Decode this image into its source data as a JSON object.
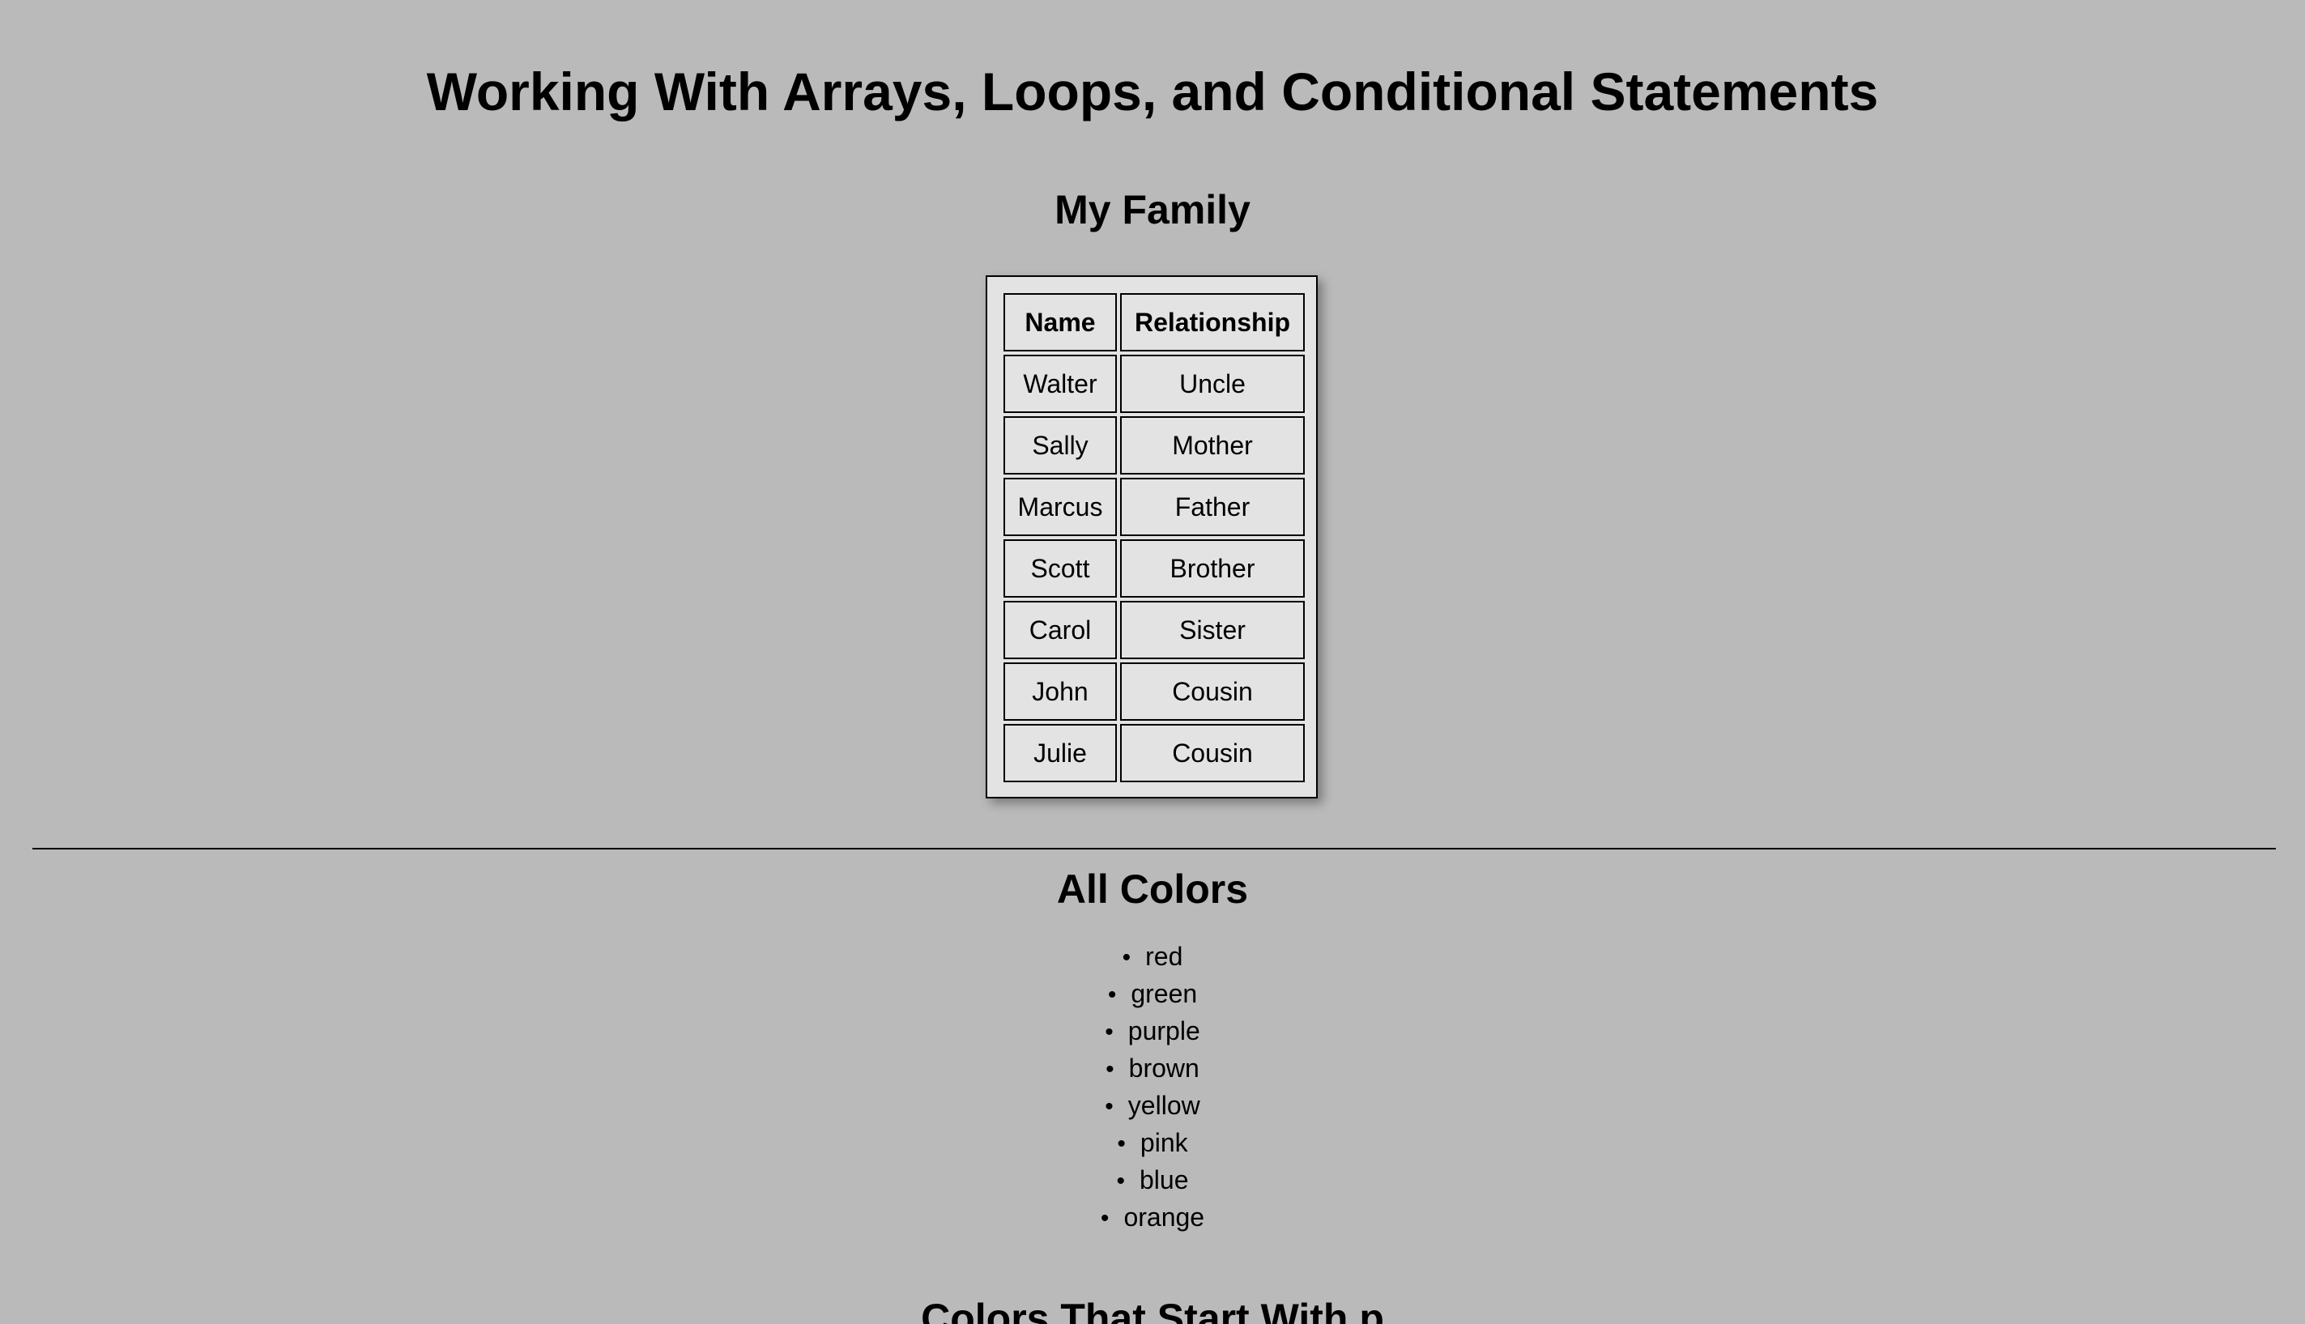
{
  "title": "Working With Arrays, Loops, and Conditional Statements",
  "family": {
    "heading": "My Family",
    "columns": [
      "Name",
      "Relationship"
    ],
    "rows": [
      [
        "Walter",
        "Uncle"
      ],
      [
        "Sally",
        "Mother"
      ],
      [
        "Marcus",
        "Father"
      ],
      [
        "Scott",
        "Brother"
      ],
      [
        "Carol",
        "Sister"
      ],
      [
        "John",
        "Cousin"
      ],
      [
        "Julie",
        "Cousin"
      ]
    ]
  },
  "all_colors": {
    "heading": "All Colors",
    "items": [
      "red",
      "green",
      "purple",
      "brown",
      "yellow",
      "pink",
      "blue",
      "orange"
    ]
  },
  "p_colors": {
    "heading": "Colors That Start With p"
  },
  "colors": {
    "background": "#bababa",
    "table_background": "#e3e3e3",
    "text": "#000000"
  }
}
